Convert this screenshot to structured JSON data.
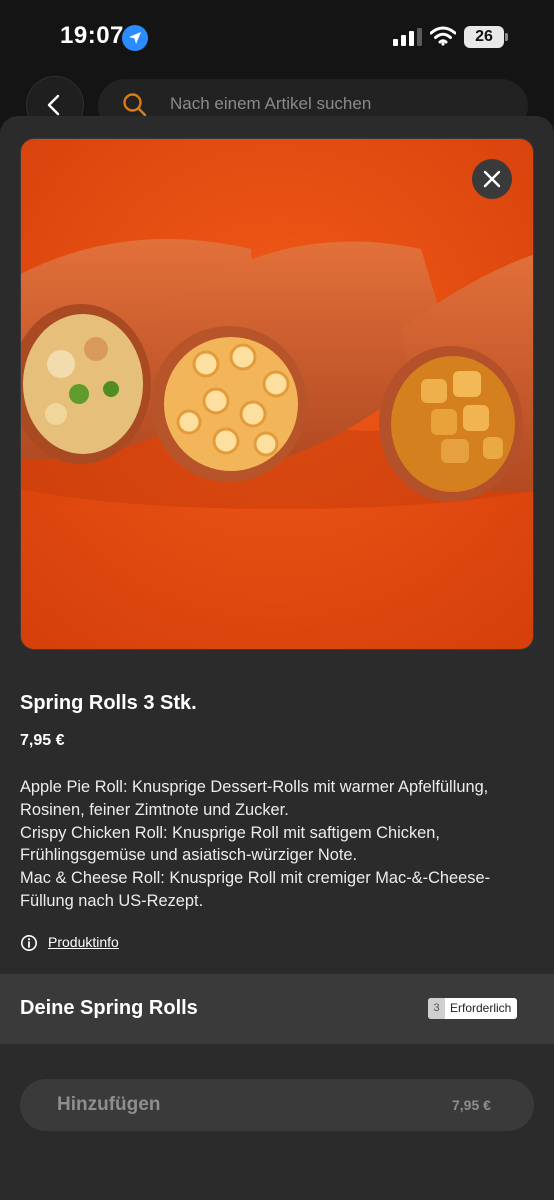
{
  "status_bar": {
    "time": "19:07",
    "battery": "26",
    "icons": [
      "location-arrow-icon",
      "cellular-signal-icon",
      "wifi-icon",
      "battery-icon"
    ]
  },
  "header": {
    "back_icon": "chevron-left-icon",
    "search_placeholder": "Nach einem Artikel suchen"
  },
  "product": {
    "title": "Spring Rolls 3 Stk.",
    "price": "7,95 €",
    "description": [
      "Apple Pie Roll: Knusprige Dessert-Rolls mit warmer Apfelfüllung, Rosinen, feiner Zimtnote und Zucker.",
      "Crispy Chicken Roll: Knusprige Roll mit saftigem Chicken, Frühlingsgemüse und asiatisch-würziger Note.",
      "Mac & Cheese Roll: Knusprige Roll mit cremiger Mac-&-Cheese-Füllung nach US-Rezept."
    ],
    "info_link": "Produktinfo"
  },
  "section": {
    "title": "Deine Spring Rolls",
    "required_count": "3",
    "required_label": "Erforderlich"
  },
  "cta": {
    "label": "Hinzufügen",
    "price": "7,95 €"
  },
  "colors": {
    "sheet_bg": "#2b2b2b",
    "hero_bg": "#e84a12",
    "accent_orange": "#d97a16",
    "location_blue": "#2a8cff"
  }
}
